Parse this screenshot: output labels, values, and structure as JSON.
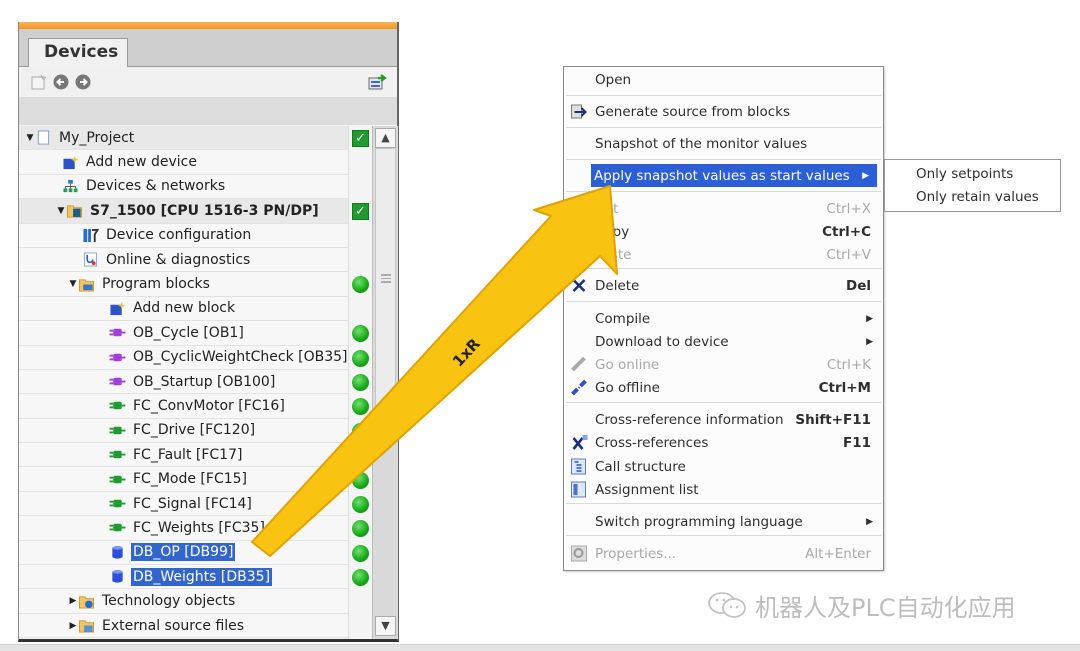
{
  "panel": {
    "tab_label": "Devices",
    "toolbar": [
      "new-item-icon",
      "back-icon",
      "forward-icon",
      "export-icon"
    ]
  },
  "tree": [
    {
      "label": "My_Project",
      "level": 0,
      "arrow": "▼",
      "icon": "project-icon",
      "status": "check",
      "hl": true
    },
    {
      "label": "Add new device",
      "level": 1,
      "arrow": "",
      "icon": "add-device-icon",
      "status": ""
    },
    {
      "label": "Devices & networks",
      "level": 1,
      "arrow": "",
      "icon": "network-icon",
      "status": ""
    },
    {
      "label": "S7_1500 [CPU 1516-3 PN/DP]",
      "level": 1,
      "arrow": "▼",
      "icon": "cpu-folder-icon",
      "status": "check",
      "hl": true,
      "bold": true
    },
    {
      "label": "Device configuration",
      "level": 2,
      "arrow": "",
      "icon": "device-config-icon",
      "status": ""
    },
    {
      "label": "Online & diagnostics",
      "level": 2,
      "arrow": "",
      "icon": "diagnostics-icon",
      "status": ""
    },
    {
      "label": "Program blocks",
      "level": 2,
      "arrow": "▼",
      "icon": "folder-icon",
      "status": "dot"
    },
    {
      "label": "Add new block",
      "level": 3,
      "arrow": "",
      "icon": "add-block-icon",
      "status": ""
    },
    {
      "label": "OB_Cycle [OB1]",
      "level": 3,
      "arrow": "",
      "icon": "ob-icon",
      "status": "dot"
    },
    {
      "label": "OB_CyclicWeightCheck [OB35]",
      "level": 3,
      "arrow": "",
      "icon": "ob-icon",
      "status": "dot"
    },
    {
      "label": "OB_Startup [OB100]",
      "level": 3,
      "arrow": "",
      "icon": "ob-icon",
      "status": "dot"
    },
    {
      "label": "FC_ConvMotor [FC16]",
      "level": 3,
      "arrow": "",
      "icon": "fc-icon",
      "status": "dot"
    },
    {
      "label": "FC_Drive [FC120]",
      "level": 3,
      "arrow": "",
      "icon": "fc-icon",
      "status": "dot"
    },
    {
      "label": "FC_Fault [FC17]",
      "level": 3,
      "arrow": "",
      "icon": "fc-icon",
      "status": "dot"
    },
    {
      "label": "FC_Mode [FC15]",
      "level": 3,
      "arrow": "",
      "icon": "fc-icon",
      "status": "dot"
    },
    {
      "label": "FC_Signal [FC14]",
      "level": 3,
      "arrow": "",
      "icon": "fc-icon",
      "status": "dot"
    },
    {
      "label": "FC_Weights [FC35]",
      "level": 3,
      "arrow": "",
      "icon": "fc-icon",
      "status": "dot"
    },
    {
      "label": "DB_OP [DB99]",
      "level": 3,
      "arrow": "",
      "icon": "db-icon",
      "status": "dot",
      "selected": true
    },
    {
      "label": "DB_Weights [DB35]",
      "level": 3,
      "arrow": "",
      "icon": "db-icon",
      "status": "dot",
      "selected": true
    },
    {
      "label": "Technology objects",
      "level": 2,
      "arrow": "▶",
      "icon": "tech-folder-icon",
      "status": ""
    },
    {
      "label": "External source files",
      "level": 2,
      "arrow": "▶",
      "icon": "source-folder-icon",
      "status": ""
    }
  ],
  "context_menu": {
    "items": [
      {
        "label": "Open",
        "shortcut": "",
        "icon": "",
        "y": 0
      },
      {
        "label": "Generate source from blocks",
        "shortcut": "",
        "icon": "generate-source-icon"
      },
      {
        "label": "Snapshot of the monitor values",
        "shortcut": "",
        "icon": ""
      },
      {
        "label": "Apply snapshot values as start values",
        "shortcut": "",
        "icon": "",
        "submenu": true,
        "active": true
      },
      {
        "label": "Cut",
        "shortcut": "Ctrl+X",
        "icon": "cut-icon",
        "disabled": true
      },
      {
        "label": "Copy",
        "shortcut": "Ctrl+C",
        "icon": "copy-icon"
      },
      {
        "label": "Paste",
        "shortcut": "Ctrl+V",
        "icon": "paste-icon",
        "disabled": true
      },
      {
        "label": "Delete",
        "shortcut": "Del",
        "icon": "delete-icon"
      },
      {
        "label": "Compile",
        "shortcut": "",
        "icon": "",
        "submenu": true
      },
      {
        "label": "Download to device",
        "shortcut": "",
        "icon": "",
        "submenu": true
      },
      {
        "label": "Go online",
        "shortcut": "Ctrl+K",
        "icon": "go-online-icon",
        "disabled": true
      },
      {
        "label": "Go offline",
        "shortcut": "Ctrl+M",
        "icon": "go-offline-icon"
      },
      {
        "label": "Cross-reference information",
        "shortcut": "Shift+F11",
        "icon": ""
      },
      {
        "label": "Cross-references",
        "shortcut": "F11",
        "icon": "cross-references-icon"
      },
      {
        "label": "Call structure",
        "shortcut": "",
        "icon": "call-structure-icon"
      },
      {
        "label": "Assignment list",
        "shortcut": "",
        "icon": "assignment-list-icon"
      },
      {
        "label": "Switch programming language",
        "shortcut": "",
        "icon": "",
        "submenu": true
      },
      {
        "label": "Properties...",
        "shortcut": "Alt+Enter",
        "icon": "properties-icon",
        "disabled": true
      }
    ],
    "submenu": [
      "Only setpoints",
      "Only retain values"
    ]
  },
  "annotation": {
    "label": "1xR",
    "color": "#f9c311"
  },
  "watermark": {
    "text": "机器人及PLC自动化应用"
  }
}
